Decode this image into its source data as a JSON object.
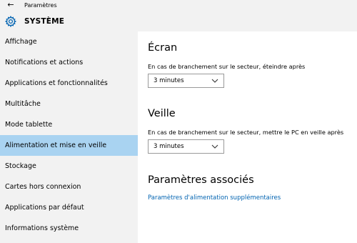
{
  "window": {
    "title": "Paramètres",
    "back_glyph": "←"
  },
  "header": {
    "section_title": "SYSTÈME"
  },
  "sidebar": {
    "items": [
      {
        "label": "Affichage",
        "active": false
      },
      {
        "label": "Notifications et actions",
        "active": false
      },
      {
        "label": "Applications et fonctionnalités",
        "active": false
      },
      {
        "label": "Multitâche",
        "active": false
      },
      {
        "label": "Mode tablette",
        "active": false
      },
      {
        "label": "Alimentation et mise en veille",
        "active": true
      },
      {
        "label": "Stockage",
        "active": false
      },
      {
        "label": "Cartes hors connexion",
        "active": false
      },
      {
        "label": "Applications par défaut",
        "active": false
      },
      {
        "label": "Informations système",
        "active": false
      }
    ]
  },
  "main": {
    "screen": {
      "heading": "Écran",
      "description": "En cas de branchement sur le secteur, éteindre après",
      "value": "3 minutes"
    },
    "sleep": {
      "heading": "Veille",
      "description": "En cas de branchement sur le secteur, mettre le PC en veille après",
      "value": "3 minutes"
    },
    "related": {
      "heading": "Paramètres associés",
      "link": "Paramètres d'alimentation supplémentaires"
    }
  },
  "colors": {
    "accent": "#0063b1",
    "selected_item": "#a9d3f1",
    "sidebar_bg": "#f2f2f2"
  },
  "icons": {
    "back": "back-arrow-icon",
    "section": "gear-icon",
    "dropdown": "chevron-down-icon"
  }
}
